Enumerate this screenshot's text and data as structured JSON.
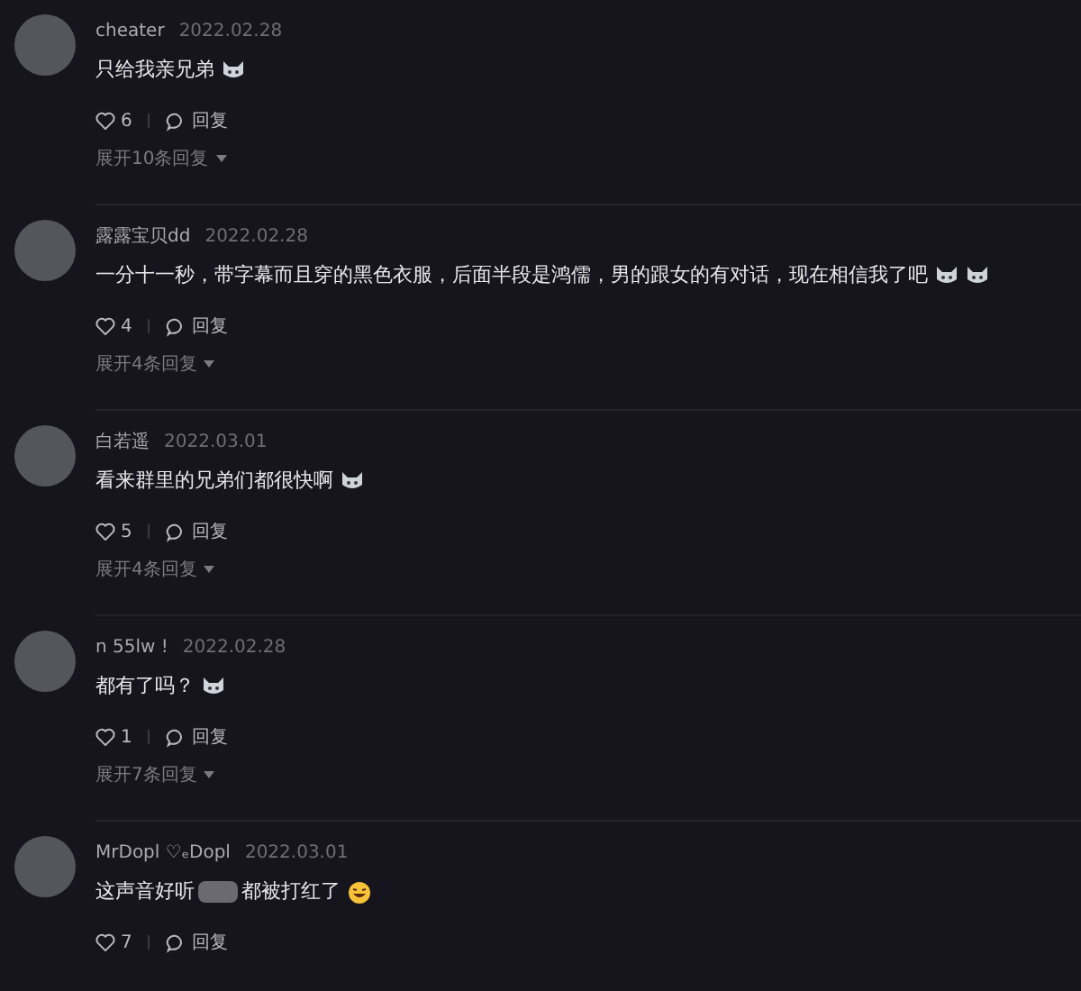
{
  "comments": [
    {
      "user": "cheater",
      "date": "2022.02.28",
      "text": "只给我亲兄弟",
      "emojis": [
        {
          "kind": "cat"
        }
      ],
      "likes": "6",
      "reply": "回复",
      "expand": "展开10条回复"
    },
    {
      "user": "露露宝贝dd",
      "date": "2022.02.28",
      "text": "一分十一秒，带字幕而且穿的黑色衣服，后面半段是鸿儒，男的跟女的有对话，现在相信我了吧",
      "emojis": [
        {
          "kind": "cat"
        },
        {
          "kind": "cat"
        }
      ],
      "likes": "4",
      "reply": "回复",
      "expand": "展开4条回复"
    },
    {
      "user": "白若遥",
      "date": "2022.03.01",
      "text": "看来群里的兄弟们都很快啊",
      "emojis": [
        {
          "kind": "cat"
        }
      ],
      "likes": "5",
      "reply": "回复",
      "expand": "展开4条回复"
    },
    {
      "user": "n 55lw !",
      "date": "2022.02.28",
      "text": "都有了吗？",
      "emojis": [
        {
          "kind": "cat"
        }
      ],
      "likes": "1",
      "reply": "回复",
      "expand": "展开7条回复"
    },
    {
      "user": "MrDopl ♡ₑDopl",
      "date": "2022.03.01",
      "text": "这声音好听",
      "text_after": "都被打红了",
      "emojis": [
        {
          "kind": "laugh"
        }
      ],
      "likes": "7",
      "reply": "回复"
    }
  ]
}
